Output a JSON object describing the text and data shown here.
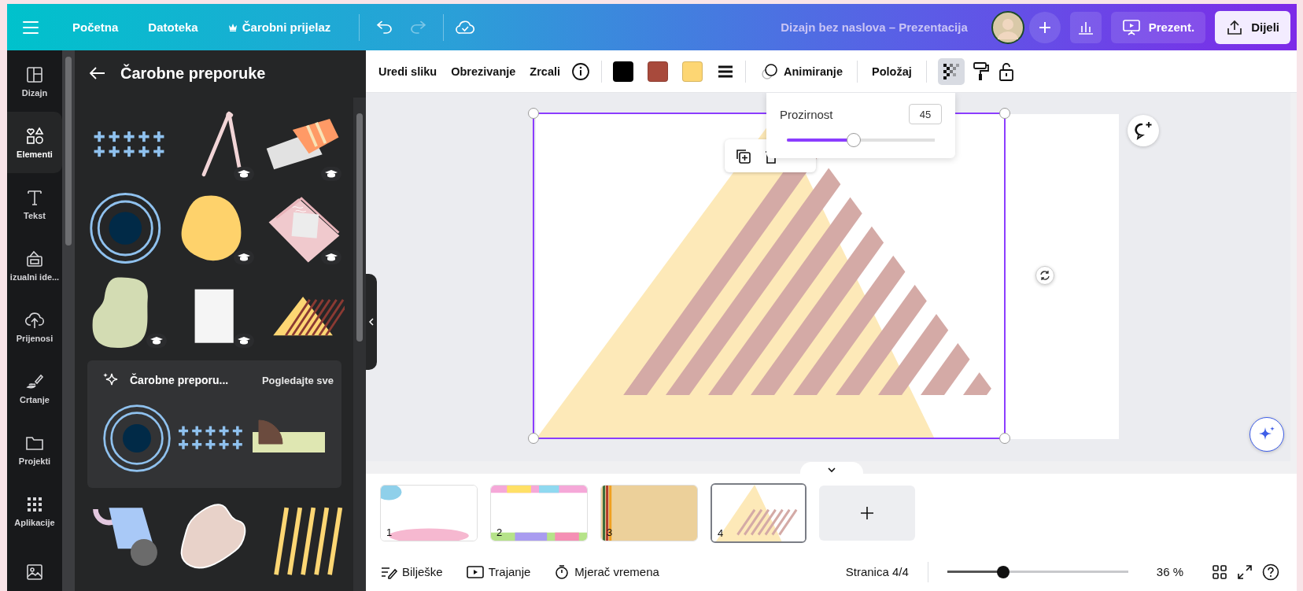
{
  "topbar": {
    "nav": [
      "Početna",
      "Datoteka",
      "Čarobni prijelaz"
    ],
    "history": [
      {
        "disabled": false
      },
      {
        "disabled": true
      }
    ],
    "title": "Dizajn bez naslova – Prezentacija",
    "present": "Prezent.",
    "share": "Dijeli"
  },
  "rail": [
    {
      "label": "Dizajn",
      "selected": false
    },
    {
      "label": "Elementi",
      "selected": true
    },
    {
      "label": "Tekst",
      "selected": false
    },
    {
      "label": "izualni ide...",
      "selected": false
    },
    {
      "label": "Prijenosi",
      "selected": false
    },
    {
      "label": "Crtanje",
      "selected": false
    },
    {
      "label": "Projekti",
      "selected": false
    },
    {
      "label": "Aplikacije",
      "selected": false
    },
    {
      "selected": false
    }
  ],
  "panel": {
    "title": "Čarobne preporuke",
    "elements": [
      {
        "premium": false
      },
      {
        "premium": true
      },
      {
        "premium": true
      },
      {
        "premium": false
      },
      {
        "premium": true
      },
      {
        "premium": true
      },
      {
        "premium": true
      },
      {
        "premium": true
      },
      {
        "premium": false
      }
    ],
    "card": {
      "title": "Čarobne preporu...",
      "link": "Pogledajte sve"
    }
  },
  "toolbar": {
    "actions": [
      "Uredi sliku",
      "Obrezivanje",
      "Zrcali"
    ],
    "swatches": [
      {
        "color": "#000000"
      },
      {
        "color": "#a84a3c"
      },
      {
        "color": "#fdd673"
      }
    ],
    "animate": "Animiranje",
    "position": "Položaj",
    "transparency_selected": true
  },
  "opacity_popup": {
    "label": "Prozirnost",
    "value": "45",
    "level": 0.45
  },
  "pages": [
    {
      "number": "1",
      "selected": false
    },
    {
      "number": "2",
      "selected": false
    },
    {
      "number": "3",
      "selected": false
    },
    {
      "number": "4",
      "selected": true
    }
  ],
  "footer": {
    "items": [
      "Bilješke",
      "Trajanje",
      "Mjerač vremena"
    ],
    "page": "Stranica 4/4",
    "zoom_slider": {
      "level": 0.31
    },
    "zoom": "36 %"
  }
}
